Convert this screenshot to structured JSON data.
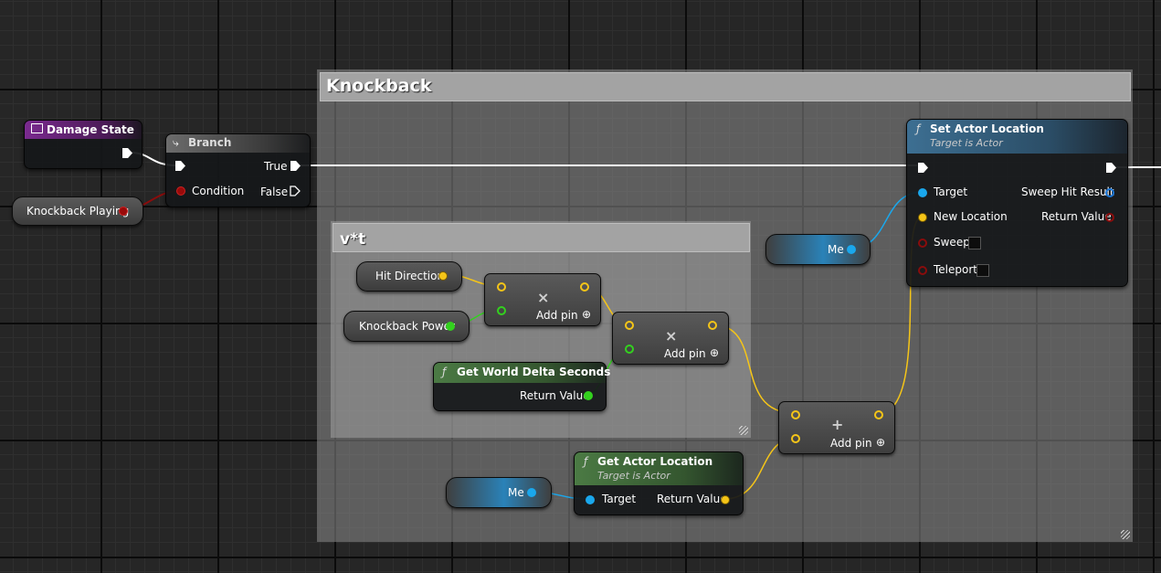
{
  "comments": {
    "knockback": {
      "title": "Knockback"
    },
    "vt": {
      "title": "v*t"
    }
  },
  "nodes": {
    "damage_state": {
      "title": "Damage State"
    },
    "knockback_playing": {
      "label": "Knockback Playing"
    },
    "branch": {
      "title": "Branch",
      "true_label": "True",
      "false_label": "False",
      "condition_label": "Condition"
    },
    "set_actor_location": {
      "title": "Set Actor Location",
      "subtitle": "Target is Actor",
      "pins": {
        "target": "Target",
        "new_location": "New Location",
        "sweep": "Sweep",
        "teleport": "Teleport",
        "sweep_hit_result": "Sweep Hit Result",
        "return_value": "Return Value"
      }
    },
    "me_top": {
      "label": "Me"
    },
    "hit_direction": {
      "label": "Hit Direction"
    },
    "knockback_power": {
      "label": "Knockback Power"
    },
    "multiply_1": {
      "op": "×",
      "add_pin": "Add pin"
    },
    "multiply_2": {
      "op": "×",
      "add_pin": "Add pin"
    },
    "get_world_delta_seconds": {
      "title": "Get World Delta Seconds",
      "return_value": "Return Value"
    },
    "add_node": {
      "op": "+",
      "add_pin": "Add pin"
    },
    "get_actor_location": {
      "title": "Get Actor Location",
      "subtitle": "Target is Actor",
      "target": "Target",
      "return_value": "Return Value"
    },
    "me_bottom": {
      "label": "Me"
    }
  },
  "colors": {
    "exec": "#ffffff",
    "vector": "#f5c518",
    "float": "#33d11e",
    "object": "#1aa7ec",
    "bool": "#9a0a0a",
    "function_header_blue": "#3d6f92",
    "function_header_green": "#3f6b3a",
    "variable_header_purple": "#7a2a8f"
  }
}
